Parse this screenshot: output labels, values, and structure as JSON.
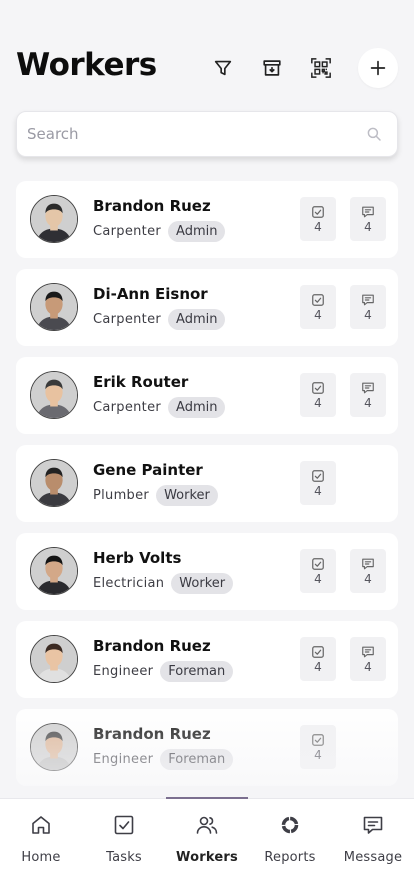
{
  "header": {
    "title": "Workers",
    "icons": [
      "filter-icon",
      "archive-icon",
      "qr-code-icon",
      "plus-icon"
    ]
  },
  "search": {
    "placeholder": "Search",
    "value": "",
    "icon": "search-icon"
  },
  "workers": [
    {
      "name": "Brandon Ruez",
      "role": "Carpenter",
      "badge": "Admin",
      "tasks": "4",
      "messages": "4"
    },
    {
      "name": "Di-Ann Eisnor",
      "role": "Carpenter",
      "badge": "Admin",
      "tasks": "4",
      "messages": "4"
    },
    {
      "name": "Erik Router",
      "role": "Carpenter",
      "badge": "Admin",
      "tasks": "4",
      "messages": "4"
    },
    {
      "name": "Gene Painter",
      "role": "Plumber",
      "badge": "Worker",
      "tasks": "4",
      "messages": null
    },
    {
      "name": "Herb Volts",
      "role": "Electrician",
      "badge": "Worker",
      "tasks": "4",
      "messages": "4"
    },
    {
      "name": "Brandon Ruez",
      "role": "Engineer",
      "badge": "Foreman",
      "tasks": "4",
      "messages": "4"
    },
    {
      "name": "Brandon Ruez",
      "role": "Engineer",
      "badge": "Foreman",
      "tasks": "4",
      "messages": null
    }
  ],
  "nav": {
    "items": [
      {
        "label": "Home",
        "icon": "home-icon"
      },
      {
        "label": "Tasks",
        "icon": "tasks-icon"
      },
      {
        "label": "Workers",
        "icon": "workers-icon",
        "active": true
      },
      {
        "label": "Reports",
        "icon": "reports-icon"
      },
      {
        "label": "Message",
        "icon": "message-icon"
      }
    ]
  },
  "colors": {
    "background": "#f5f5f7",
    "accent": "#7b6f8f",
    "badge": "#e3e3e7",
    "card": "#ffffff"
  }
}
